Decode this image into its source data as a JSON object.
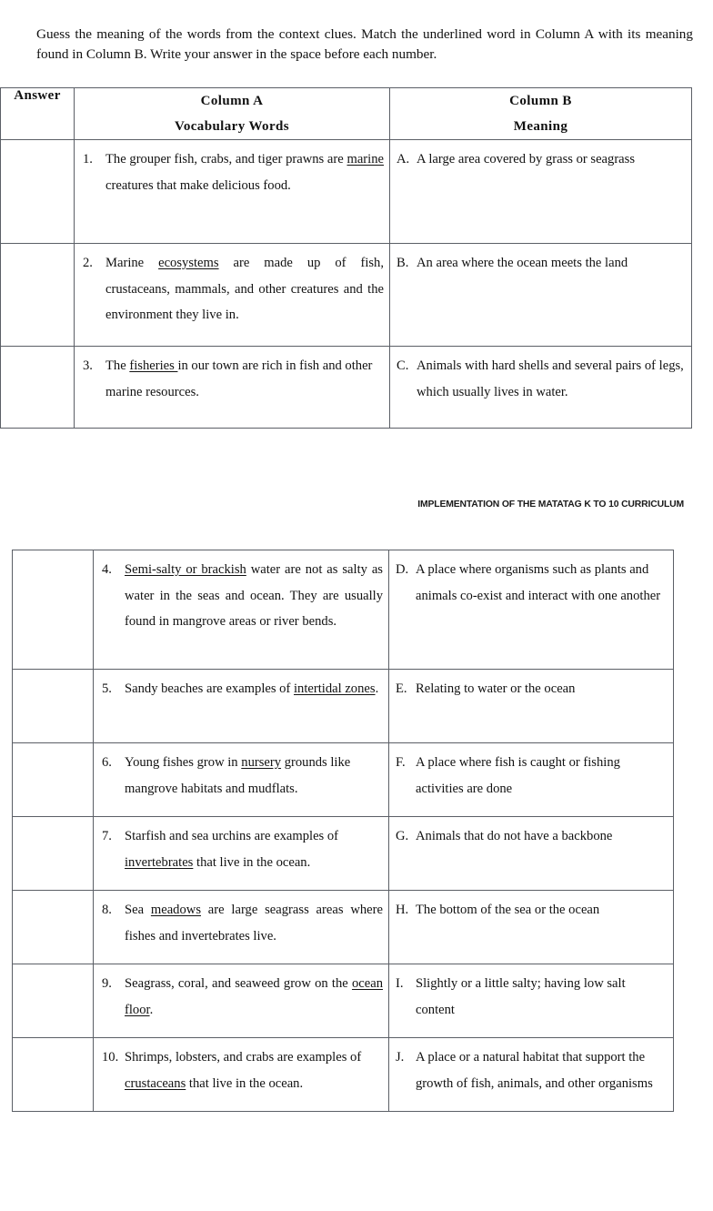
{
  "document": {
    "instructions": "Guess the meaning of the words from the context clues. Match the underlined word in Column A with its meaning found in Column B. Write your answer in the space before each number.",
    "running_head": "IMPLEMENTATION OF THE MATATAG K TO 10 CURRICULUM"
  },
  "table": {
    "headers": {
      "answer": "Answer",
      "column_a_line1": "Column A",
      "column_a_line2": "Vocabulary Words",
      "column_b_line1": "Column B",
      "column_b_line2": "Meaning"
    }
  },
  "items": [
    {
      "number": "1.",
      "text_before": "The grouper fish, crabs, and tiger prawns are ",
      "underlined": "marine",
      "text_after": " creatures that make delicious food.",
      "answer": ""
    },
    {
      "number": "2.",
      "text_before": "Marine ",
      "underlined": "ecosystems",
      "text_after": " are made up of fish, crustaceans, mammals, and other creatures and the environment they live in.",
      "answer": ""
    },
    {
      "number": "3.",
      "text_before": "The ",
      "underlined": "fisheries ",
      "text_after": "in our town are rich in fish and other marine resources.",
      "answer": ""
    },
    {
      "number": "4.",
      "text_before": "",
      "underlined": "Semi-salty or brackish",
      "text_after": " water are not as salty as water in the seas and ocean. They are usually found in mangrove areas or river bends.",
      "answer": ""
    },
    {
      "number": "5.",
      "text_before": "Sandy beaches are examples of ",
      "underlined": "intertidal zones",
      "text_after": ".",
      "answer": ""
    },
    {
      "number": "6.",
      "text_before": "Young fishes grow in ",
      "underlined": "nursery",
      "text_after": " grounds like mangrove habitats and mudflats.",
      "answer": ""
    },
    {
      "number": "7.",
      "text_before": "Starfish and sea urchins are examples of ",
      "underlined": "invertebrates",
      "text_after": " that live in the ocean.",
      "answer": ""
    },
    {
      "number": "8.",
      "text_before": "Sea ",
      "underlined": "meadows",
      "text_after": " are large seagrass areas where fishes and invertebrates live.",
      "answer": ""
    },
    {
      "number": "9.",
      "text_before": "Seagrass, coral, and seaweed grow on the ",
      "underlined": "ocean floor",
      "text_after": ".",
      "answer": ""
    },
    {
      "number": "10.",
      "text_before": "Shrimps, lobsters, and crabs are examples of ",
      "underlined": "crustaceans",
      "text_after": " that live in the ocean.",
      "answer": ""
    }
  ],
  "meanings": [
    {
      "letter": "A.",
      "text": "A large area covered by grass or seagrass"
    },
    {
      "letter": "B.",
      "text": "An area where the ocean meets the land"
    },
    {
      "letter": "C.",
      "text": "Animals with hard shells and several pairs of legs, which usually lives in water."
    },
    {
      "letter": "D.",
      "text": "A place where organisms such as plants and animals co-exist and interact with one another"
    },
    {
      "letter": "E.",
      "text": "Relating to water or the ocean"
    },
    {
      "letter": "F.",
      "text": "A place where fish is caught or fishing activities are done"
    },
    {
      "letter": "G.",
      "text": "Animals that do not have a backbone"
    },
    {
      "letter": "H.",
      "text": "The bottom of the sea or the ocean"
    },
    {
      "letter": "I.",
      "text": "Slightly or a little salty; having low salt content"
    },
    {
      "letter": "J.",
      "text": "A place or a natural habitat that support the growth of fish, animals, and other organisms"
    }
  ]
}
